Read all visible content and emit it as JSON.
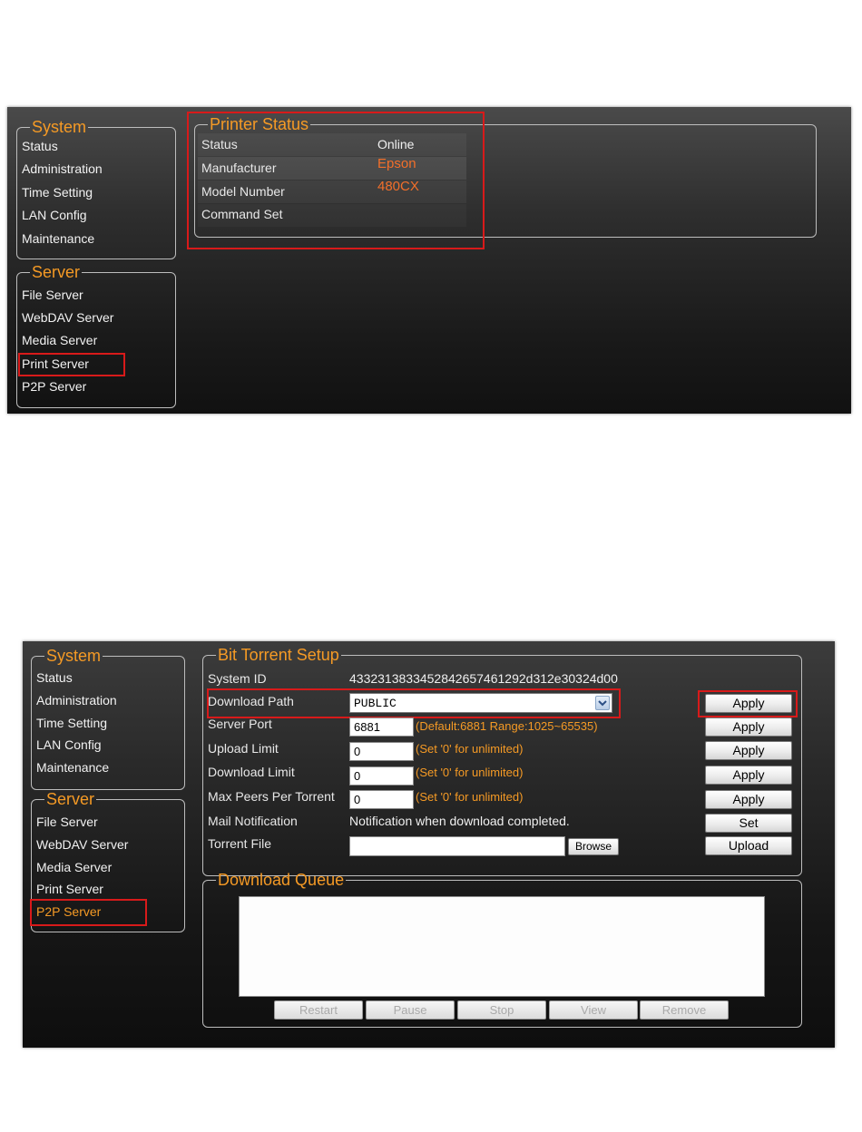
{
  "screen1": {
    "system": {
      "legend": "System",
      "items": [
        "Status",
        "Administration",
        "Time Setting",
        "LAN Config",
        "Maintenance"
      ]
    },
    "server": {
      "legend": "Server",
      "items": [
        "File Server",
        "WebDAV Server",
        "Media Server",
        "Print Server",
        "P2P Server"
      ],
      "selected": "Print Server"
    },
    "printer_status": {
      "legend": "Printer Status",
      "rows": [
        {
          "label": "Status",
          "value": "Online"
        },
        {
          "label": "Manufacturer",
          "value": "Epson"
        },
        {
          "label": "Model Number",
          "value": "480CX"
        },
        {
          "label": "Command Set",
          "value": ""
        }
      ]
    }
  },
  "screen2": {
    "system": {
      "legend": "System",
      "items": [
        "Status",
        "Administration",
        "Time Setting",
        "LAN Config",
        "Maintenance"
      ]
    },
    "server": {
      "legend": "Server",
      "items": [
        "File Server",
        "WebDAV Server",
        "Media Server",
        "Print Server",
        "P2P Server"
      ],
      "selected": "P2P Server"
    },
    "bittorrent": {
      "legend": "Bit Torrent Setup",
      "system_id_label": "System ID",
      "system_id_value": "43323138334528426574612​92d312e30324d00",
      "download_path_label": "Download Path",
      "download_path_value": "PUBLIC",
      "server_port_label": "Server Port",
      "server_port_value": "6881",
      "server_port_hint": "(Default:6881 Range:1025~65535)",
      "upload_limit_label": "Upload Limit",
      "upload_limit_value": "0",
      "upload_limit_hint": "(Set '0' for unlimited)",
      "download_limit_label": "Download Limit",
      "download_limit_value": "0",
      "download_limit_hint": "(Set '0' for unlimited)",
      "max_peers_label": "Max Peers Per Torrent",
      "max_peers_value": "0",
      "max_peers_hint": "(Set '0' for unlimited)",
      "mail_label": "Mail Notification",
      "mail_value": "Notification when download completed.",
      "torrent_file_label": "Torrent File",
      "torrent_file_value": "",
      "browse_label": "Browse",
      "apply_label": "Apply",
      "set_label": "Set",
      "upload_label": "Upload"
    },
    "queue": {
      "legend": "Download Queue",
      "buttons": [
        "Restart",
        "Pause",
        "Stop",
        "View",
        "Remove"
      ]
    }
  },
  "colors": {
    "accent_orange": "#f59a25",
    "value_orange": "#f26f2a",
    "highlight_red": "#d81a1a"
  }
}
